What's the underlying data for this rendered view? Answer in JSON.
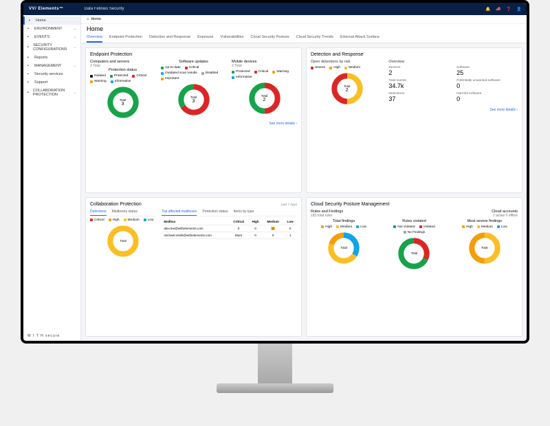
{
  "brand": "VV/ Elements™",
  "org": "Data Fellows Security",
  "watermark": "W I T H  secure",
  "breadcrumb": {
    "icon": "home",
    "label": "Home"
  },
  "pageTitle": "Home",
  "tabs": [
    "Overview",
    "Endpoint Protection",
    "Detection and Response",
    "Exposure",
    "Vulnerabilities",
    "Cloud Security Posture",
    "Cloud Security Trends",
    "External Attack Surface"
  ],
  "activeTab": 0,
  "sidebar": [
    {
      "label": "Home",
      "icon": "home",
      "active": true
    },
    {
      "label": "ENVIRONMENT",
      "icon": "globe",
      "chev": true
    },
    {
      "label": "EVENTS",
      "icon": "bars",
      "chev": true
    },
    {
      "label": "SECURITY CONFIGURATIONS",
      "icon": "sliders",
      "chev": true
    },
    {
      "label": "Reports",
      "icon": "chart"
    },
    {
      "label": "MANAGEMENT",
      "icon": "gear",
      "chev": true
    },
    {
      "label": "Security services",
      "icon": "shield"
    },
    {
      "label": "Support",
      "icon": "support"
    },
    {
      "label": "COLLABORATION PROTECTION",
      "icon": "collab",
      "chev": true
    }
  ],
  "epp": {
    "title": "Endpoint Protection",
    "sections": [
      {
        "group": "Computers and servers",
        "groupSub": "3 Total",
        "title": "Protection status",
        "legend": [
          {
            "c": "#111",
            "l": "Isolated"
          },
          {
            "c": "#16a34a",
            "l": "Protected"
          },
          {
            "c": "#dc2626",
            "l": "Critical"
          },
          {
            "c": "#f59e0b",
            "l": "Warning"
          },
          {
            "c": "#0ea5e9",
            "l": "Informative"
          }
        ],
        "centerLabel": "Total",
        "centerVal": "3"
      },
      {
        "title": "Software updates",
        "legend": [
          {
            "c": "#16a34a",
            "l": "Up-to-date"
          },
          {
            "c": "#dc2626",
            "l": "Critical"
          },
          {
            "c": "#0ea5e9",
            "l": "Outdated scan results"
          },
          {
            "c": "#9ca3af",
            "l": "Disabled"
          },
          {
            "c": "#f59e0b",
            "l": "Important"
          }
        ],
        "centerLabel": "Total",
        "centerVal": "3"
      },
      {
        "group": "Mobile devices",
        "groupSub": "2 Total",
        "title": "",
        "legend": [
          {
            "c": "#16a34a",
            "l": "Protected"
          },
          {
            "c": "#dc2626",
            "l": "Critical"
          },
          {
            "c": "#f59e0b",
            "l": "Warning"
          },
          {
            "c": "#0ea5e9",
            "l": "Informative"
          }
        ],
        "centerLabel": "Total",
        "centerVal": "2"
      }
    ],
    "seeMore": "See more details ›"
  },
  "dr": {
    "title": "Detection and Response",
    "openTitle": "Open detections by risk",
    "legend": [
      {
        "c": "#dc2626",
        "l": "Severe"
      },
      {
        "c": "#f59e0b",
        "l": "High"
      },
      {
        "c": "#fbbf24",
        "l": "Medium"
      }
    ],
    "centerLabel": "Total",
    "centerVal": "2",
    "overview": "Overview",
    "stats": [
      {
        "l": "Devices",
        "v": "2"
      },
      {
        "l": "Software",
        "v": "25"
      },
      {
        "l": "Total events",
        "v": "34.7k"
      },
      {
        "l": "Potentially unwanted software",
        "v": "0"
      },
      {
        "l": "Detections",
        "v": "37"
      },
      {
        "l": "Harmful software",
        "v": "0"
      }
    ],
    "seeMore": "See more details ›"
  },
  "collab": {
    "title": "Collaboration Protection",
    "period": "Last 7 days",
    "tabsLeft": [
      "Detections",
      "Mailboxes status"
    ],
    "tabsRight": [
      "Top affected mailboxes",
      "Protection status",
      "Items by type"
    ],
    "legend": [
      {
        "c": "#dc2626",
        "l": "Critical"
      },
      {
        "c": "#f59e0b",
        "l": "High"
      },
      {
        "c": "#fbbf24",
        "l": "Medium"
      },
      {
        "c": "#0ea5e9",
        "l": "Low"
      }
    ],
    "centerLabel": "Total",
    "table": {
      "headers": [
        "Mailbox",
        "Critical",
        "High",
        "Medium",
        "Low"
      ],
      "rows": [
        [
          "alex.lee@withelements.com",
          "0",
          "0",
          "2",
          "0"
        ],
        [
          "michael.smith@withelements.com",
          "More",
          "0",
          "0",
          "1",
          "0"
        ]
      ]
    }
  },
  "cspm": {
    "title": "Cloud Security Posture Management",
    "rf": "Rules and Findings",
    "rfSub": "183 total rules",
    "ca": "Cloud accounts",
    "caSub": "2 active 0 offline",
    "cols": [
      {
        "t": "Total findings",
        "legend": [
          {
            "c": "#f59e0b",
            "l": "High"
          },
          {
            "c": "#fbbf24",
            "l": "Medium"
          },
          {
            "c": "#0ea5e9",
            "l": "Low"
          }
        ]
      },
      {
        "t": "Rules violated",
        "legend": [
          {
            "c": "#16a34a",
            "l": "Not violated"
          },
          {
            "c": "#dc2626",
            "l": "Violated"
          },
          {
            "c": "#9ca3af",
            "l": "No Findings"
          }
        ]
      },
      {
        "t": "Most severe findings",
        "legend": [
          {
            "c": "#f59e0b",
            "l": "High"
          },
          {
            "c": "#fbbf24",
            "l": "Medium"
          },
          {
            "c": "#0ea5e9",
            "l": "Low"
          }
        ]
      }
    ],
    "centerLabel": "Total"
  },
  "colors": {
    "green": "#16a34a",
    "red": "#dc2626",
    "amber": "#f59e0b",
    "yellow": "#fbbf24",
    "blue": "#0ea5e9",
    "gray": "#9ca3af"
  },
  "chart_data": [
    {
      "type": "pie",
      "title": "Protection status (Computers and servers)",
      "categories": [
        "Protected"
      ],
      "values": [
        3
      ]
    },
    {
      "type": "pie",
      "title": "Software updates",
      "categories": [
        "Up-to-date",
        "Critical"
      ],
      "values": [
        1,
        2
      ]
    },
    {
      "type": "pie",
      "title": "Mobile devices",
      "categories": [
        "Protected",
        "Critical"
      ],
      "values": [
        1,
        1
      ]
    },
    {
      "type": "pie",
      "title": "Open detections by risk",
      "categories": [
        "Severe",
        "Medium"
      ],
      "values": [
        1,
        1
      ]
    },
    {
      "type": "pie",
      "title": "Collaboration Detections",
      "categories": [
        "Medium"
      ],
      "values": [
        3
      ]
    },
    {
      "type": "pie",
      "title": "CSPM Total findings",
      "categories": [
        "High",
        "Medium",
        "Low"
      ],
      "values": [
        30,
        90,
        63
      ]
    },
    {
      "type": "pie",
      "title": "CSPM Rules violated",
      "categories": [
        "Not violated",
        "Violated"
      ],
      "values": [
        130,
        53
      ]
    },
    {
      "type": "pie",
      "title": "CSPM Most severe findings",
      "categories": [
        "High",
        "Medium",
        "Low"
      ],
      "values": [
        1,
        1,
        0
      ]
    }
  ]
}
